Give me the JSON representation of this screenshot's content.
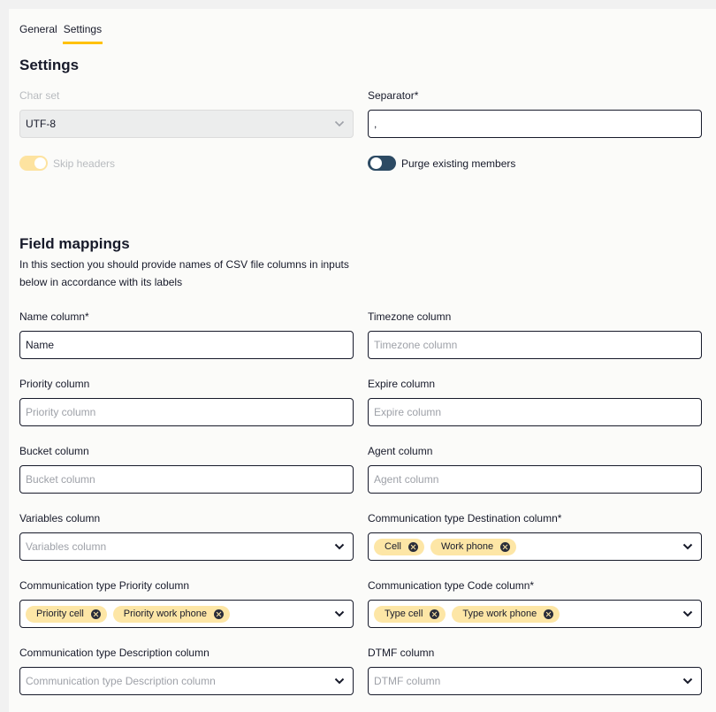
{
  "tabs": [
    "General",
    "Settings"
  ],
  "settings": {
    "title": "Settings",
    "charset": {
      "label": "Char set",
      "value": "UTF-8"
    },
    "separator": {
      "label": "Separator*",
      "value": ","
    },
    "skip_headers": {
      "label": "Skip headers",
      "checked": true,
      "disabled": true
    },
    "purge_members": {
      "label": "Purge existing members",
      "checked": false
    }
  },
  "mappings": {
    "title": "Field mappings",
    "description": "In this section you should provide names of CSV file columns in inputs below in accordance with its labels",
    "name": {
      "label": "Name column*",
      "value": "Name"
    },
    "timezone": {
      "label": "Timezone column",
      "placeholder": "Timezone column"
    },
    "priority": {
      "label": "Priority column",
      "placeholder": "Priority column"
    },
    "expire": {
      "label": "Expire column",
      "placeholder": "Expire column"
    },
    "bucket": {
      "label": "Bucket column",
      "placeholder": "Bucket column"
    },
    "agent": {
      "label": "Agent column",
      "placeholder": "Agent column"
    },
    "variables": {
      "label": "Variables column",
      "placeholder": "Variables column"
    },
    "comm_destination": {
      "label": "Communication type Destination column*",
      "chips": [
        "Cell",
        "Work phone"
      ]
    },
    "comm_priority": {
      "label": "Communication type Priority column",
      "chips": [
        "Priority cell",
        "Priority work phone"
      ]
    },
    "comm_code": {
      "label": "Communication type Code column*",
      "chips": [
        "Type cell",
        "Type work phone"
      ]
    },
    "comm_description": {
      "label": "Communication type Description column",
      "placeholder": "Communication type Description column"
    },
    "dtmf": {
      "label": "DTMF column",
      "placeholder": "DTMF column"
    }
  },
  "colors": {
    "accent": "#ffc107",
    "chip": "#fde6a6",
    "toggle_off": "#2c4a63",
    "text": "#171a2a"
  },
  "icons": {
    "select": "chevron-down-icon",
    "chip_remove": "close-circle-icon"
  }
}
